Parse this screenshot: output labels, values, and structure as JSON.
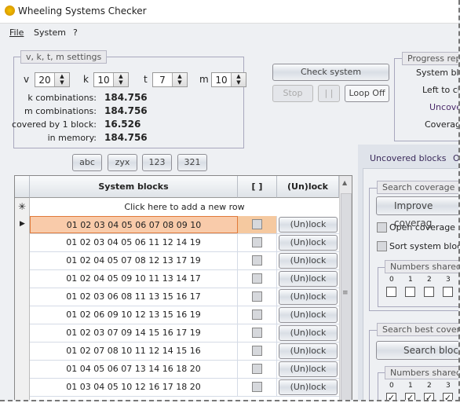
{
  "window": {
    "title": "Wheeling Systems Checker"
  },
  "menu": [
    "File",
    "System",
    "?"
  ],
  "settings": {
    "legend": "v, k, t, m settings",
    "params": [
      {
        "label": "v",
        "value": "20"
      },
      {
        "label": "k",
        "value": "10"
      },
      {
        "label": "t",
        "value": "7"
      },
      {
        "label": "m",
        "value": "10"
      }
    ],
    "stats": [
      {
        "label": "k combinations:",
        "value": "184.756"
      },
      {
        "label": "m combinations:",
        "value": "184.756"
      },
      {
        "label": "covered by 1 block:",
        "value": "16.526"
      },
      {
        "label": "in memory:",
        "value": "184.756"
      }
    ]
  },
  "sort_buttons": [
    "abc",
    "zyx",
    "123",
    "321"
  ],
  "controls": {
    "check": "Check system",
    "stop": "Stop",
    "pause": "| |",
    "loop": "Loop Off"
  },
  "progress": {
    "legend": "Progress rep",
    "labels": [
      "System blo",
      "Left to ch",
      "Uncove",
      "Coverag"
    ]
  },
  "grid": {
    "headers": [
      "System blocks",
      "[ ]",
      "(Un)lock"
    ],
    "new_row": "Click here to add a new row",
    "lock_label": "(Un)lock",
    "rows": [
      "01 02 03 04 05 06 07 08 09 10",
      "01 02 03 04 05 06 11 12 14 19",
      "01 02 04 05 07 08 12 13 17 19",
      "01 02 04 05 09 10 11 13 14 17",
      "01 02 03 06 08 11 13 15 16 17",
      "01 02 06 09 10 12 13 15 16 19",
      "01 02 03 07 09 14 15 16 17 19",
      "01 02 07 08 10 11 12 14 15 16",
      "01 04 05 06 07 13 14 16 18 20",
      "01 03 04 05 10 12 16 17 18 20"
    ]
  },
  "tabs": [
    "Uncovered blocks",
    "O"
  ],
  "coverage": {
    "legend": "Search coverage im",
    "improve": "Improve coverag",
    "open": "Open coverage im",
    "sort": "Sort system block",
    "shared_legend": "Numbers shared",
    "numbers": [
      "0",
      "1",
      "2",
      "3"
    ]
  },
  "best": {
    "legend": "Search best coverin",
    "search": "Search blocks",
    "shared_legend": "Numbers shared",
    "numbers": [
      "0",
      "1",
      "2",
      "3"
    ]
  }
}
